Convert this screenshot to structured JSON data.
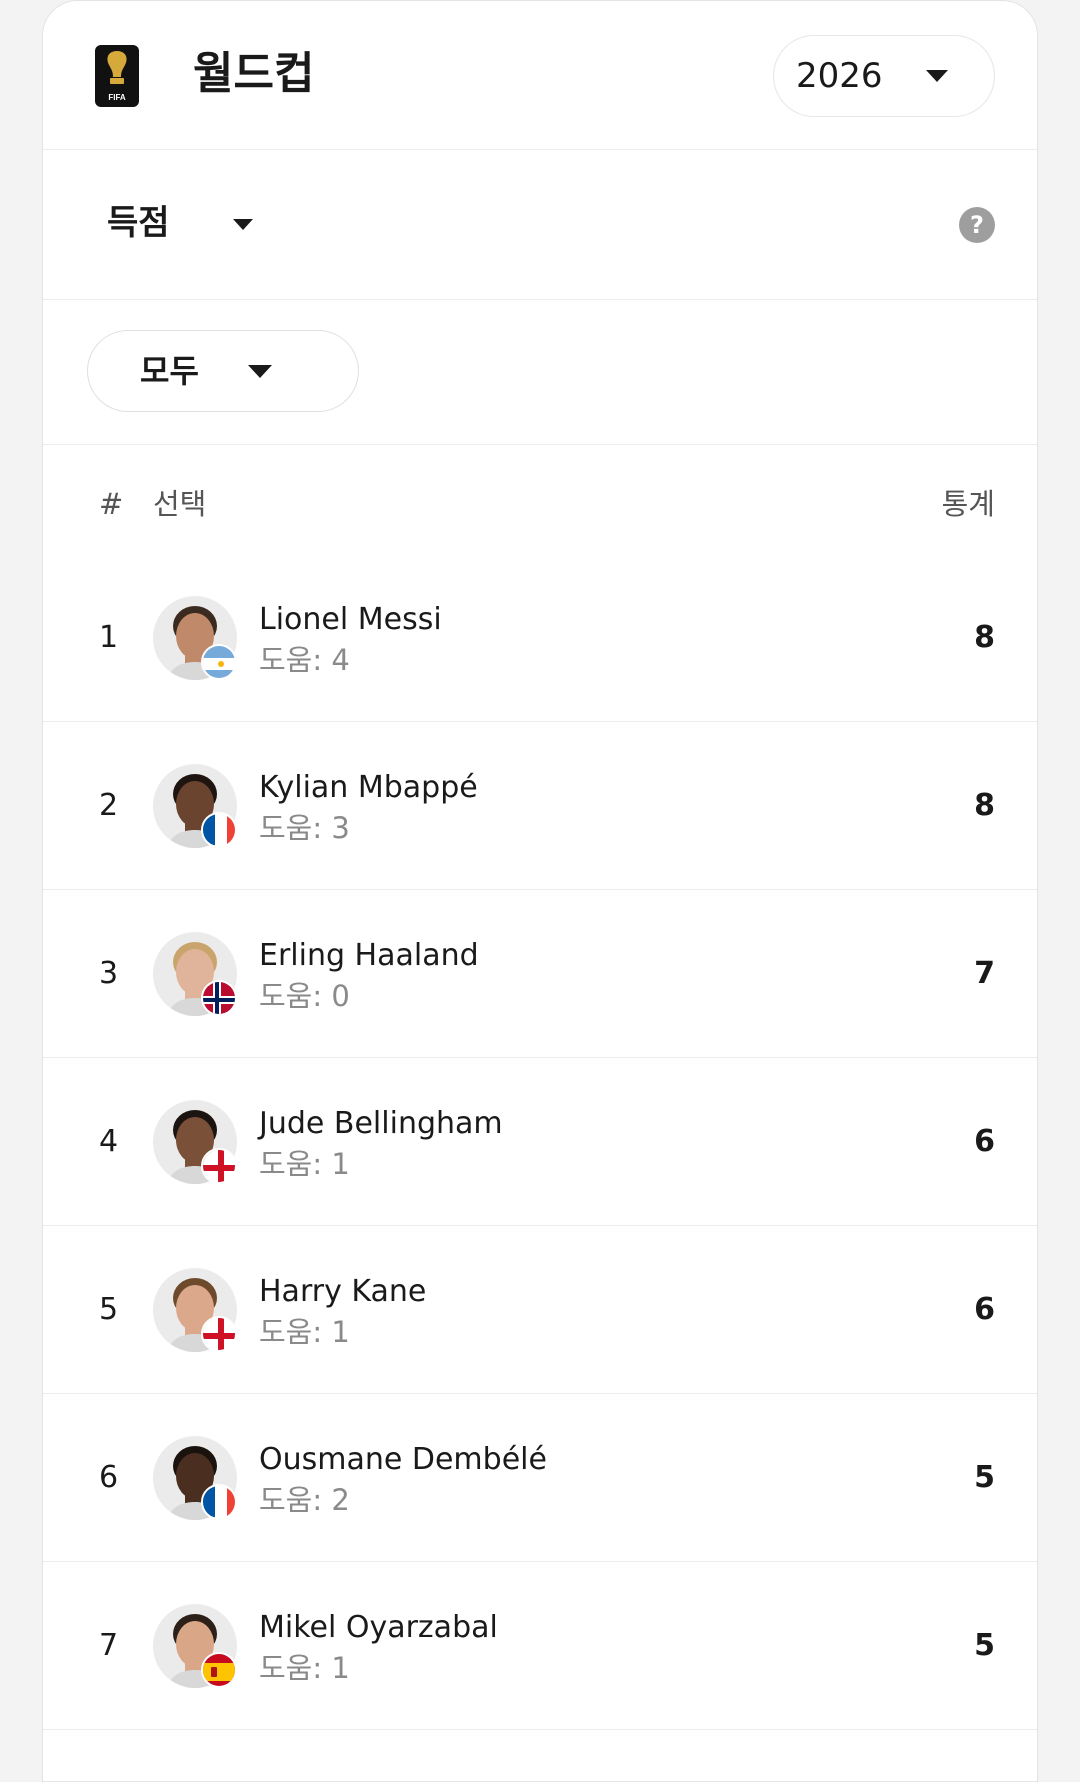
{
  "header": {
    "title": "월드컵",
    "season": "2026"
  },
  "stat_selector": {
    "label": "득점",
    "help": "?"
  },
  "filter": {
    "label": "모두"
  },
  "table": {
    "col_rank": "#",
    "col_player": "선택",
    "col_stat": "통계",
    "rows": [
      {
        "rank": "1",
        "name": "Lionel Messi",
        "assists": "도움: 4",
        "value": "8",
        "country": "Argentina",
        "flag_icon": "argentina-flag-icon",
        "skin": "#c08a6a",
        "hair": "#3b2a20"
      },
      {
        "rank": "2",
        "name": "Kylian Mbappé",
        "assists": "도움: 3",
        "value": "8",
        "country": "France",
        "flag_icon": "france-flag-icon",
        "skin": "#6b4430",
        "hair": "#1f1510"
      },
      {
        "rank": "3",
        "name": "Erling Haaland",
        "assists": "도움: 0",
        "value": "7",
        "country": "Norway",
        "flag_icon": "norway-flag-icon",
        "skin": "#e0b49a",
        "hair": "#c9a46c"
      },
      {
        "rank": "4",
        "name": "Jude Bellingham",
        "assists": "도움: 1",
        "value": "6",
        "country": "England",
        "flag_icon": "england-flag-icon",
        "skin": "#7a5038",
        "hair": "#1c1410"
      },
      {
        "rank": "5",
        "name": "Harry Kane",
        "assists": "도움: 1",
        "value": "6",
        "country": "England",
        "flag_icon": "england-flag-icon",
        "skin": "#dba88c",
        "hair": "#6e4a2c"
      },
      {
        "rank": "6",
        "name": "Ousmane Dembélé",
        "assists": "도움: 2",
        "value": "5",
        "country": "France",
        "flag_icon": "france-flag-icon",
        "skin": "#4a2e20",
        "hair": "#1a120d"
      },
      {
        "rank": "7",
        "name": "Mikel Oyarzabal",
        "assists": "도움: 1",
        "value": "5",
        "country": "Spain",
        "flag_icon": "spain-flag-icon",
        "skin": "#d9a688",
        "hair": "#2c2018"
      }
    ]
  }
}
